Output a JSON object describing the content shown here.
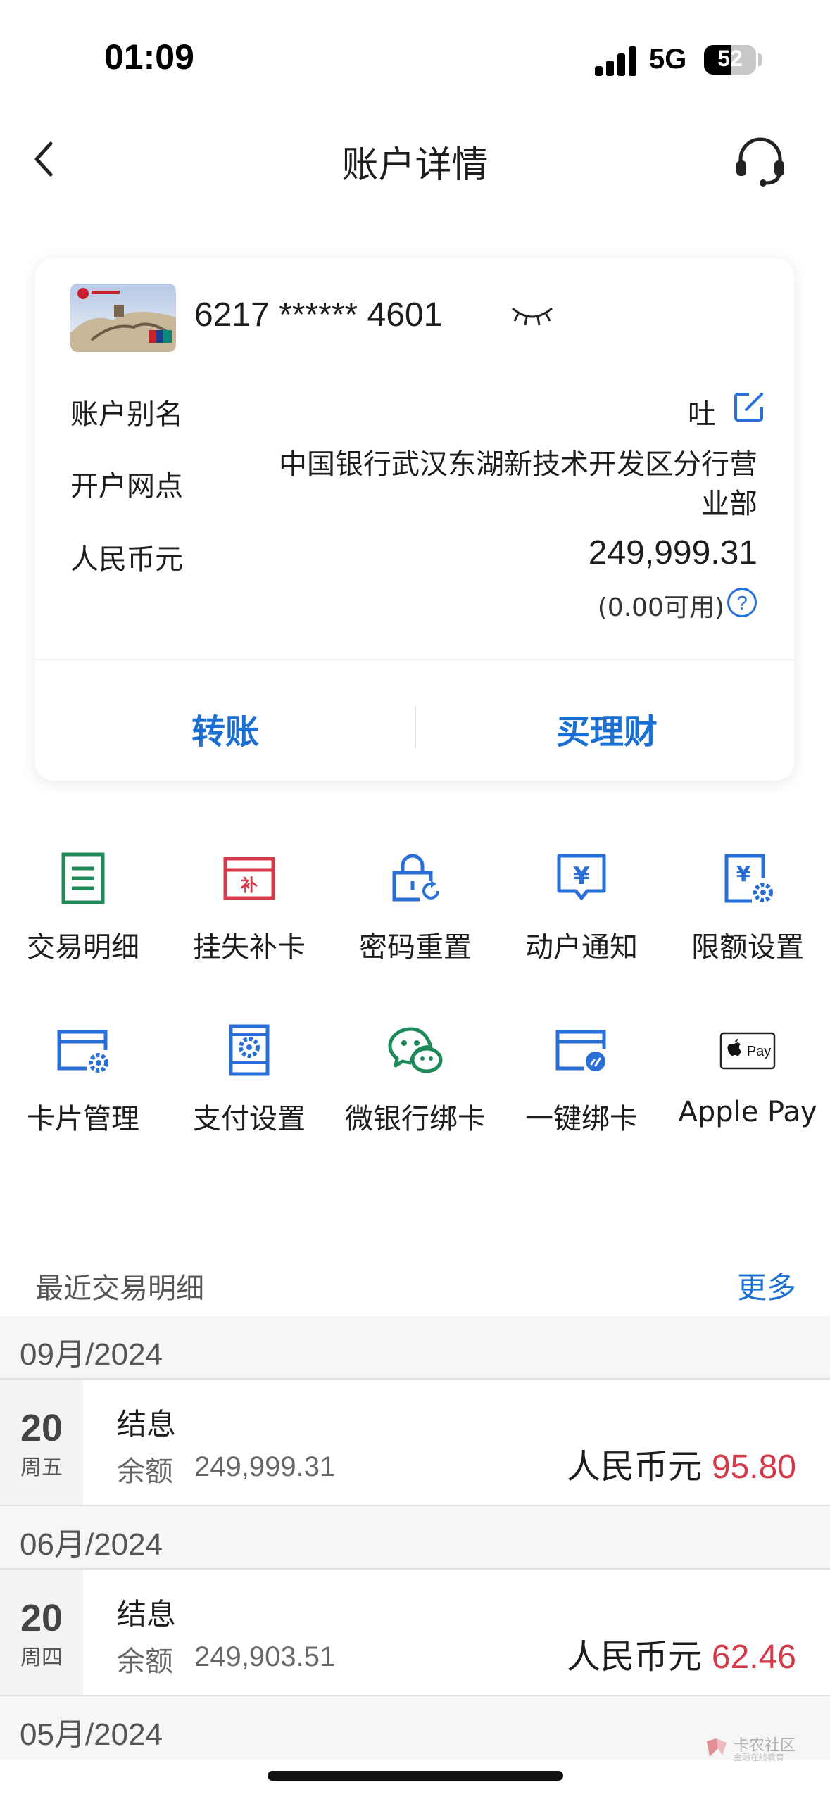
{
  "status_bar": {
    "time": "01:09",
    "network": "5G",
    "battery": "52"
  },
  "nav": {
    "title": "账户详情"
  },
  "card": {
    "number": "6217 ****** 4601",
    "alias_label": "账户别名",
    "alias_value": "吐",
    "branch_label": "开户网点",
    "branch_value": "中国银行武汉东湖新技术开发区分行营业部",
    "currency_label": "人民币元",
    "balance": "249,999.31",
    "available": "(0.00可用)",
    "help_glyph": "?"
  },
  "actions": {
    "transfer": "转账",
    "wealth": "买理财"
  },
  "grid": [
    {
      "label": "交易明细",
      "icon": "list-icon",
      "color": "#1e8a5a"
    },
    {
      "label": "挂失补卡",
      "icon": "report-loss-card-icon",
      "color": "#d63a4a"
    },
    {
      "label": "密码重置",
      "icon": "lock-reset-icon",
      "color": "#2a6fd6"
    },
    {
      "label": "动户通知",
      "icon": "yuan-notice-icon",
      "color": "#2a6fd6"
    },
    {
      "label": "限额设置",
      "icon": "yuan-settings-icon",
      "color": "#2a6fd6"
    },
    {
      "label": "卡片管理",
      "icon": "card-gear-icon",
      "color": "#2a6fd6"
    },
    {
      "label": "支付设置",
      "icon": "payment-settings-icon",
      "color": "#2a6fd6"
    },
    {
      "label": "微银行绑卡",
      "icon": "wechat-icon",
      "color": "#1e8a5a"
    },
    {
      "label": "一键绑卡",
      "icon": "card-link-icon",
      "color": "#2a6fd6"
    },
    {
      "label": "Apple Pay",
      "icon": "apple-pay-icon",
      "color": "#000000"
    }
  ],
  "recent": {
    "title": "最近交易明细",
    "more": "更多",
    "groups": [
      {
        "month": "09月/2024",
        "day": "20",
        "weekday": "周五",
        "type": "结息",
        "balance_label": "余额",
        "balance": "249,999.31",
        "currency": "人民币元",
        "amount": "95.80"
      },
      {
        "month": "06月/2024",
        "day": "20",
        "weekday": "周四",
        "type": "结息",
        "balance_label": "余额",
        "balance": "249,903.51",
        "currency": "人民币元",
        "amount": "62.46"
      },
      {
        "month": "05月/2024"
      }
    ]
  },
  "watermark": {
    "title": "卡农社区",
    "subtitle": "金融在线教育"
  }
}
